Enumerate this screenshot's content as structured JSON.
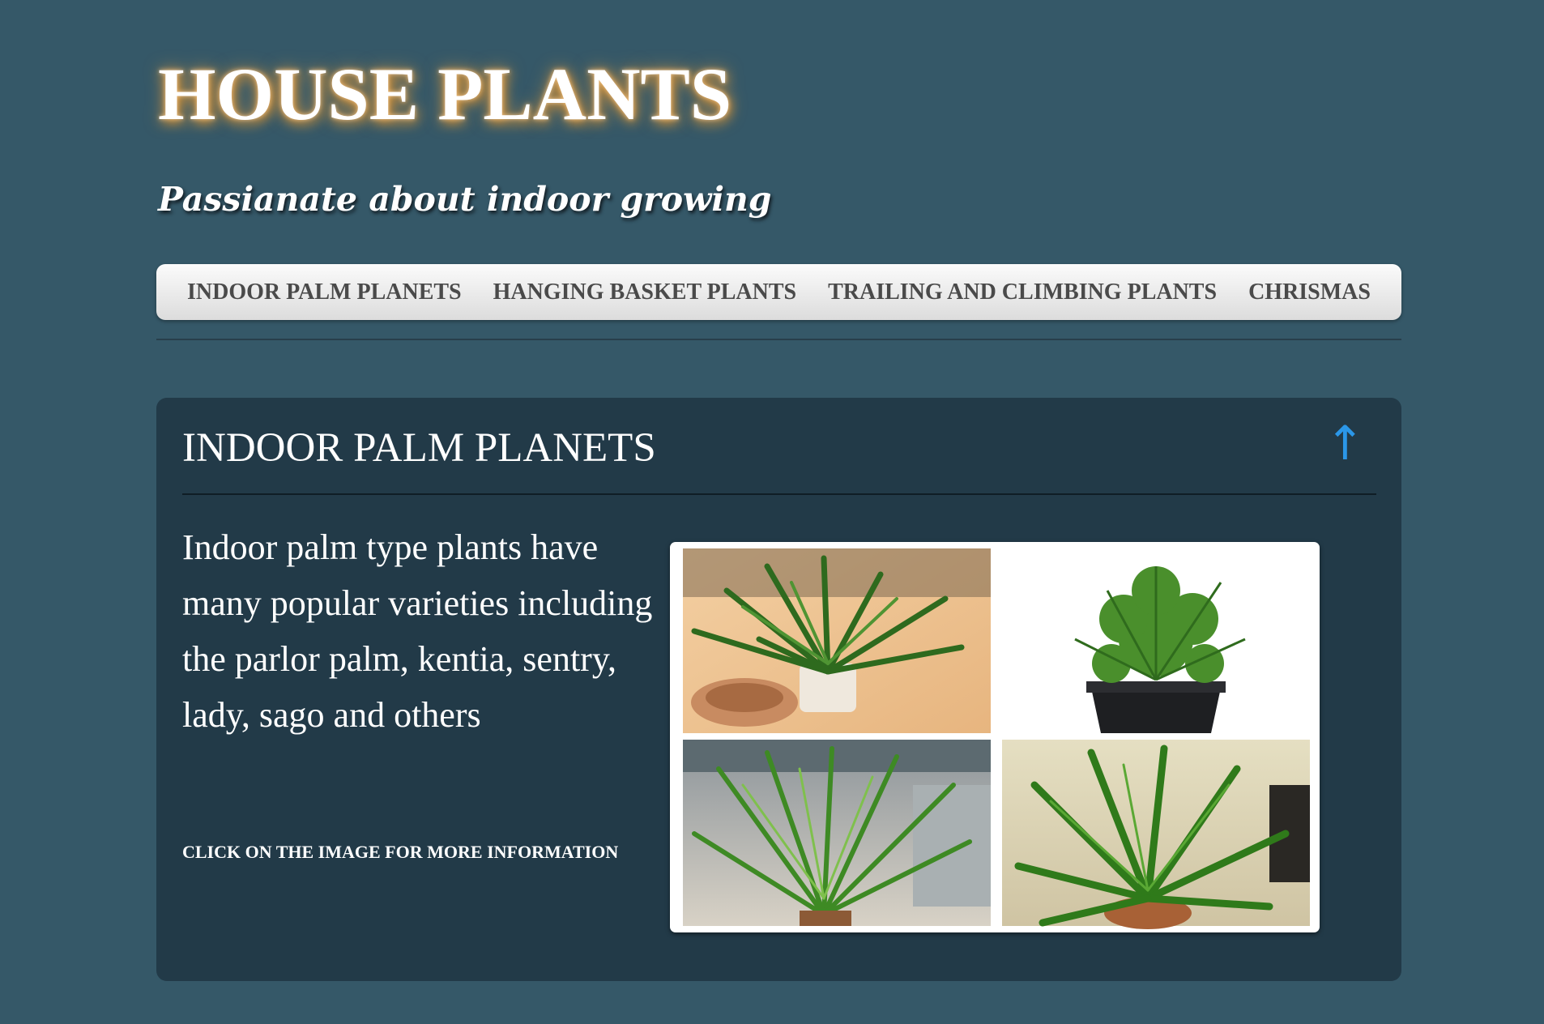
{
  "header": {
    "title": "HOUSE PLANTS",
    "tagline": "Passianate about indoor growing"
  },
  "nav": {
    "items": [
      {
        "label": "INDOOR PALM PLANETS"
      },
      {
        "label": "HANGING BASKET PLANTS"
      },
      {
        "label": "TRAILING AND CLIMBING PLANTS"
      },
      {
        "label": "CHRISMAS"
      }
    ]
  },
  "section": {
    "heading": "INDOOR PALM PLANETS",
    "back_to_top_glyph": "↑",
    "description": "Indoor palm type plants have many popular varieties including the parlor palm, kentia, sentry, lady, sago and others",
    "cta": "CLICK ON THE IMAGE FOR MORE INFORMATION",
    "image_icon": "palm-collage-image"
  },
  "colors": {
    "page_background": "#355868",
    "panel_background": "#223a48",
    "nav_background": "#e9e9e9",
    "nav_text": "#4a4a4a",
    "title_glow": "#d9912f",
    "arrow": "#2b97e8"
  }
}
